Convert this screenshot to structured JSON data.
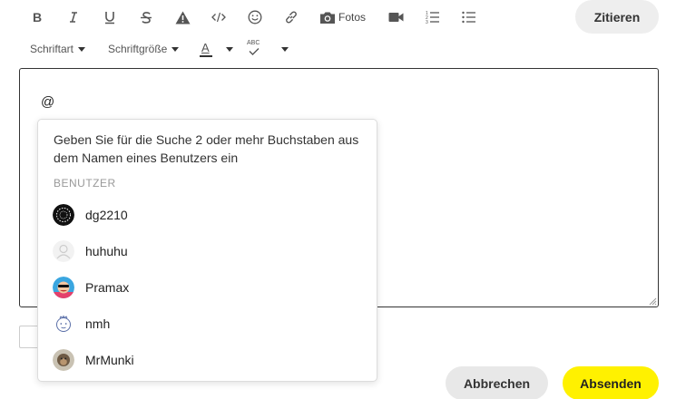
{
  "toolbar": {
    "icons": [
      "bold-icon",
      "italic-icon",
      "underline-icon",
      "strikethrough-icon",
      "warning-icon",
      "code-icon",
      "emoji-icon",
      "link-icon",
      "camera-icon",
      "video-icon",
      "numbered-list-icon",
      "bullet-list-icon"
    ],
    "fotos_label": "Fotos",
    "quote_label": "Zitieren",
    "font_label": "Schriftart",
    "font_size_label": "Schriftgröße",
    "text_color_glyph": "A",
    "spellcheck_glyph": "ABC"
  },
  "editor": {
    "content": "@"
  },
  "mention_popup": {
    "hint": "Geben Sie für die Suche 2 oder mehr Buchstaben aus dem Namen eines Benutzers ein",
    "section_label": "BENUTZER",
    "users": [
      {
        "name": "dg2210"
      },
      {
        "name": "huhuhu"
      },
      {
        "name": "Pramax"
      },
      {
        "name": "nmh"
      },
      {
        "name": "MrMunki"
      }
    ]
  },
  "footer": {
    "cancel_label": "Abbrechen",
    "send_label": "Absenden"
  },
  "colors": {
    "accent": "#fff100",
    "secondary_button": "#e8e8e8"
  }
}
